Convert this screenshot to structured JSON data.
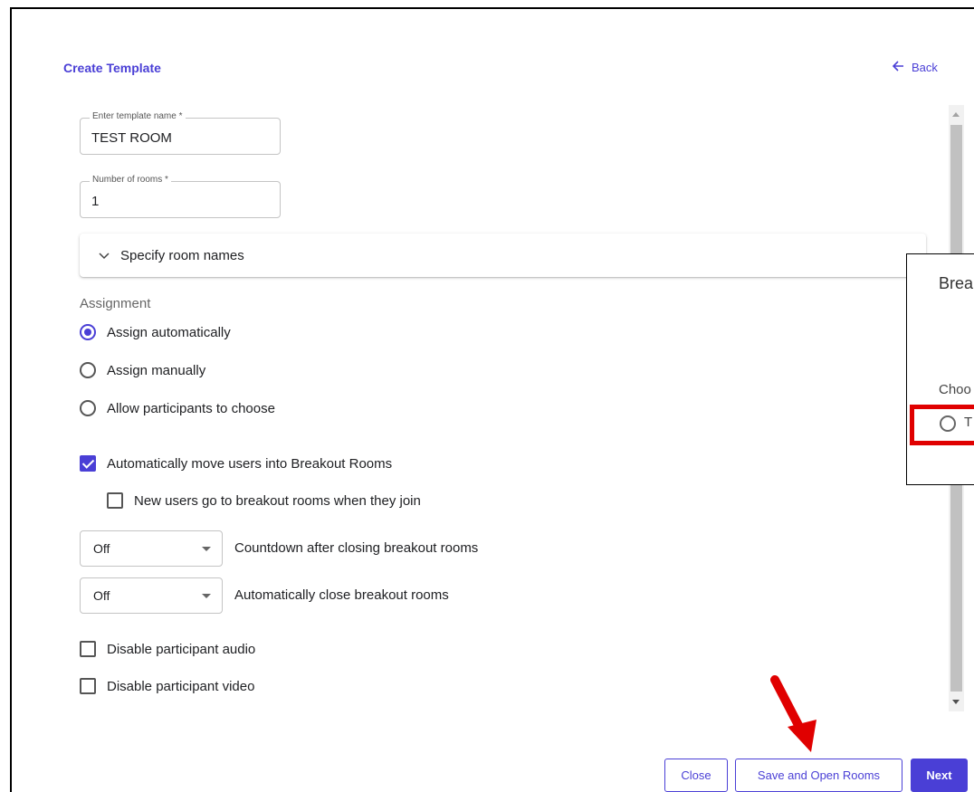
{
  "header": {
    "title": "Create Template",
    "back_label": "Back"
  },
  "fields": {
    "template_name": {
      "label": "Enter template name *",
      "value": "TEST ROOM"
    },
    "room_count": {
      "label": "Number of rooms *",
      "value": "1"
    }
  },
  "room_names": {
    "label": "Specify room names"
  },
  "assignment": {
    "label": "Assignment",
    "options": [
      {
        "label": "Assign automatically",
        "selected": true
      },
      {
        "label": "Assign manually",
        "selected": false
      },
      {
        "label": "Allow participants to choose",
        "selected": false
      }
    ]
  },
  "auto_move": {
    "label": "Automatically move users into Breakout Rooms",
    "checked": true
  },
  "new_users": {
    "label": "New users go to breakout rooms when they join",
    "checked": false
  },
  "countdown": {
    "value": "Off",
    "label": "Countdown after closing breakout rooms"
  },
  "auto_close": {
    "value": "Off",
    "label": "Automatically close breakout rooms"
  },
  "disable_audio": {
    "label": "Disable participant audio",
    "checked": false
  },
  "disable_video": {
    "label": "Disable participant video",
    "checked": false
  },
  "popup": {
    "title": "Brea",
    "choose_label": "Choo",
    "option_text": "T"
  },
  "footer": {
    "close_label": "Close",
    "save_open_label": "Save and Open Rooms",
    "next_label": "Next"
  },
  "colors": {
    "accent": "#4a3fd6",
    "annotation_red": "#e00000"
  }
}
